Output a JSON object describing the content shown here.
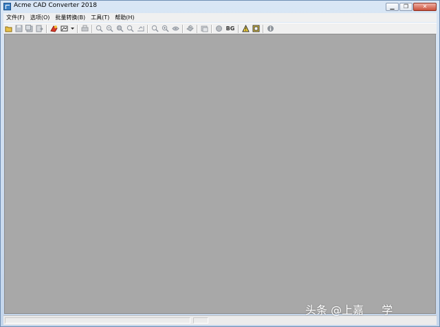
{
  "window": {
    "title": "Acme CAD Converter 2018",
    "buttons": [
      "minimize",
      "restore",
      "close"
    ]
  },
  "menubar": {
    "items": [
      "文件(F)",
      "选项(O)",
      "批量转换(B)",
      "工具(T)",
      "帮助(H)"
    ]
  },
  "toolbar": {
    "bg_label": "BG",
    "icons": [
      "open-folder-icon",
      "save-icon",
      "save-all-icon",
      "export-icon",
      "convert-icon",
      "view-dropdown-icon",
      "print-icon",
      "zoom-in-icon",
      "zoom-out-icon",
      "zoom-window-icon",
      "zoom-extents-icon",
      "zoom-previous-icon",
      "zoom-realtime-icon",
      "pan-icon",
      "layer-icon",
      "redraw-icon",
      "color-icon",
      "background-icon",
      "warning-icon",
      "frame-icon",
      "info-icon"
    ]
  },
  "watermark": {
    "text": "头条 @上嘉 　 学"
  },
  "colors": {
    "workspace": "#a8a8a8",
    "titlebar": "#c9d9ee",
    "close_button": "#c9503a"
  }
}
